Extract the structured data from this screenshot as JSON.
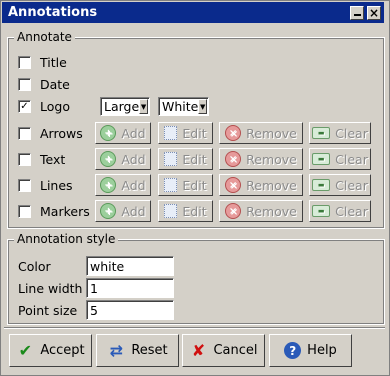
{
  "window": {
    "title": "Annotations"
  },
  "annotate": {
    "group_title": "Annotate",
    "title_cb": {
      "label": "Title",
      "checked": false
    },
    "date_cb": {
      "label": "Date",
      "checked": false
    },
    "logo_cb": {
      "label": "Logo",
      "checked": true,
      "size": "Large",
      "color": "White"
    },
    "rows": [
      {
        "label": "Arrows",
        "checked": false
      },
      {
        "label": "Text",
        "checked": false
      },
      {
        "label": "Lines",
        "checked": false
      },
      {
        "label": "Markers",
        "checked": false
      }
    ],
    "buttons": {
      "add": "Add",
      "edit": "Edit",
      "remove": "Remove",
      "clear": "Clear"
    }
  },
  "style": {
    "group_title": "Annotation style",
    "color_label": "Color",
    "color_value": "white",
    "linewidth_label": "Line width",
    "linewidth_value": "1",
    "pointsize_label": "Point size",
    "pointsize_value": "5"
  },
  "actions": {
    "accept": "Accept",
    "reset": "Reset",
    "cancel": "Cancel",
    "help": "Help"
  },
  "check_glyph": "✓"
}
